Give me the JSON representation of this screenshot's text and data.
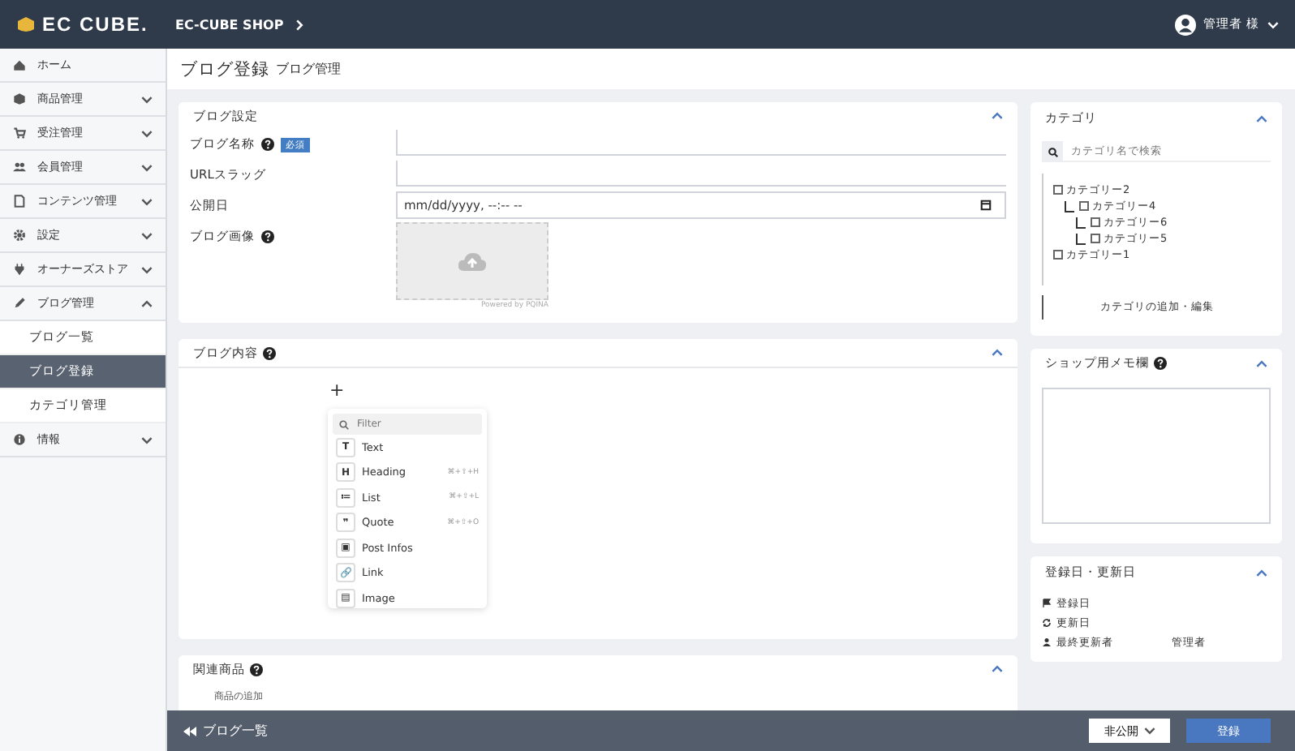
{
  "header": {
    "logo": "EC CUBE.",
    "shop": "EC-CUBE SHOP",
    "user": "管理者 様"
  },
  "sidebar": {
    "items": [
      {
        "label": "ホーム",
        "kind": "link"
      },
      {
        "label": "商品管理",
        "kind": "group",
        "expanded": false
      },
      {
        "label": "受注管理",
        "kind": "group",
        "expanded": false
      },
      {
        "label": "会員管理",
        "kind": "group",
        "expanded": false
      },
      {
        "label": "コンテンツ管理",
        "kind": "group",
        "expanded": false
      },
      {
        "label": "設定",
        "kind": "group",
        "expanded": false
      },
      {
        "label": "オーナーズストア",
        "kind": "group",
        "expanded": false
      },
      {
        "label": "ブログ管理",
        "kind": "group",
        "expanded": true,
        "children": [
          {
            "label": "ブログ一覧",
            "selected": false
          },
          {
            "label": "ブログ登録",
            "selected": true
          },
          {
            "label": "カテゴリ管理",
            "selected": false
          }
        ]
      },
      {
        "label": "情報",
        "kind": "group",
        "expanded": false
      }
    ]
  },
  "page_title": "ブログ登録",
  "page_subtitle": "ブログ管理",
  "settings": {
    "title": "ブログ設定",
    "fields": [
      {
        "label": "ブログ名称",
        "kind": "text",
        "help": true,
        "badge": "必須"
      },
      {
        "label": "URLスラッグ",
        "kind": "text",
        "help": false
      },
      {
        "label": "公開日",
        "kind": "date",
        "help": false,
        "placeholder": "mm/dd/yyyy, --:-- --"
      },
      {
        "label": "ブログ画像",
        "kind": "image",
        "help": true,
        "powered": "Powered by PQINA"
      }
    ]
  },
  "content": {
    "title": "ブログ内容",
    "add_button": "+",
    "filter_placeholder": "Filter",
    "blocks": [
      {
        "label": "Text",
        "icon": "T"
      },
      {
        "label": "Heading",
        "icon": "H",
        "shortcut": "⌘+⇧+H"
      },
      {
        "label": "List",
        "icon": "≔",
        "shortcut": "⌘+⇧+L"
      },
      {
        "label": "Quote",
        "icon": "❞",
        "shortcut": "⌘+⇧+O"
      },
      {
        "label": "Post Infos",
        "icon": "▣"
      },
      {
        "label": "Link",
        "icon": "🔗"
      },
      {
        "label": "Image",
        "icon": "▤"
      }
    ]
  },
  "related": {
    "title": "関連商品",
    "button": "商品の追加"
  },
  "category": {
    "title": "カテゴリ",
    "search_placeholder": "カテゴリ名で検索",
    "tree": [
      {
        "label": "カテゴリー2",
        "checked": false,
        "children": [
          {
            "label": "カテゴリー4",
            "checked": false,
            "children": [
              {
                "label": "カテゴリー6",
                "checked": false
              },
              {
                "label": "カテゴリー5",
                "checked": false
              }
            ]
          }
        ]
      },
      {
        "label": "カテゴリー1",
        "checked": false
      }
    ],
    "edit_button": "カテゴリの追加・編集"
  },
  "memo": {
    "title": "ショップ用メモ欄"
  },
  "dates": {
    "title": "登録日・更新日",
    "rows": [
      {
        "label": "登録日"
      },
      {
        "label": "更新日"
      },
      {
        "label": "最終更新者",
        "value": "管理者"
      }
    ]
  },
  "footer": {
    "back": "ブログ一覧",
    "status": "非公開",
    "submit": "登録"
  }
}
